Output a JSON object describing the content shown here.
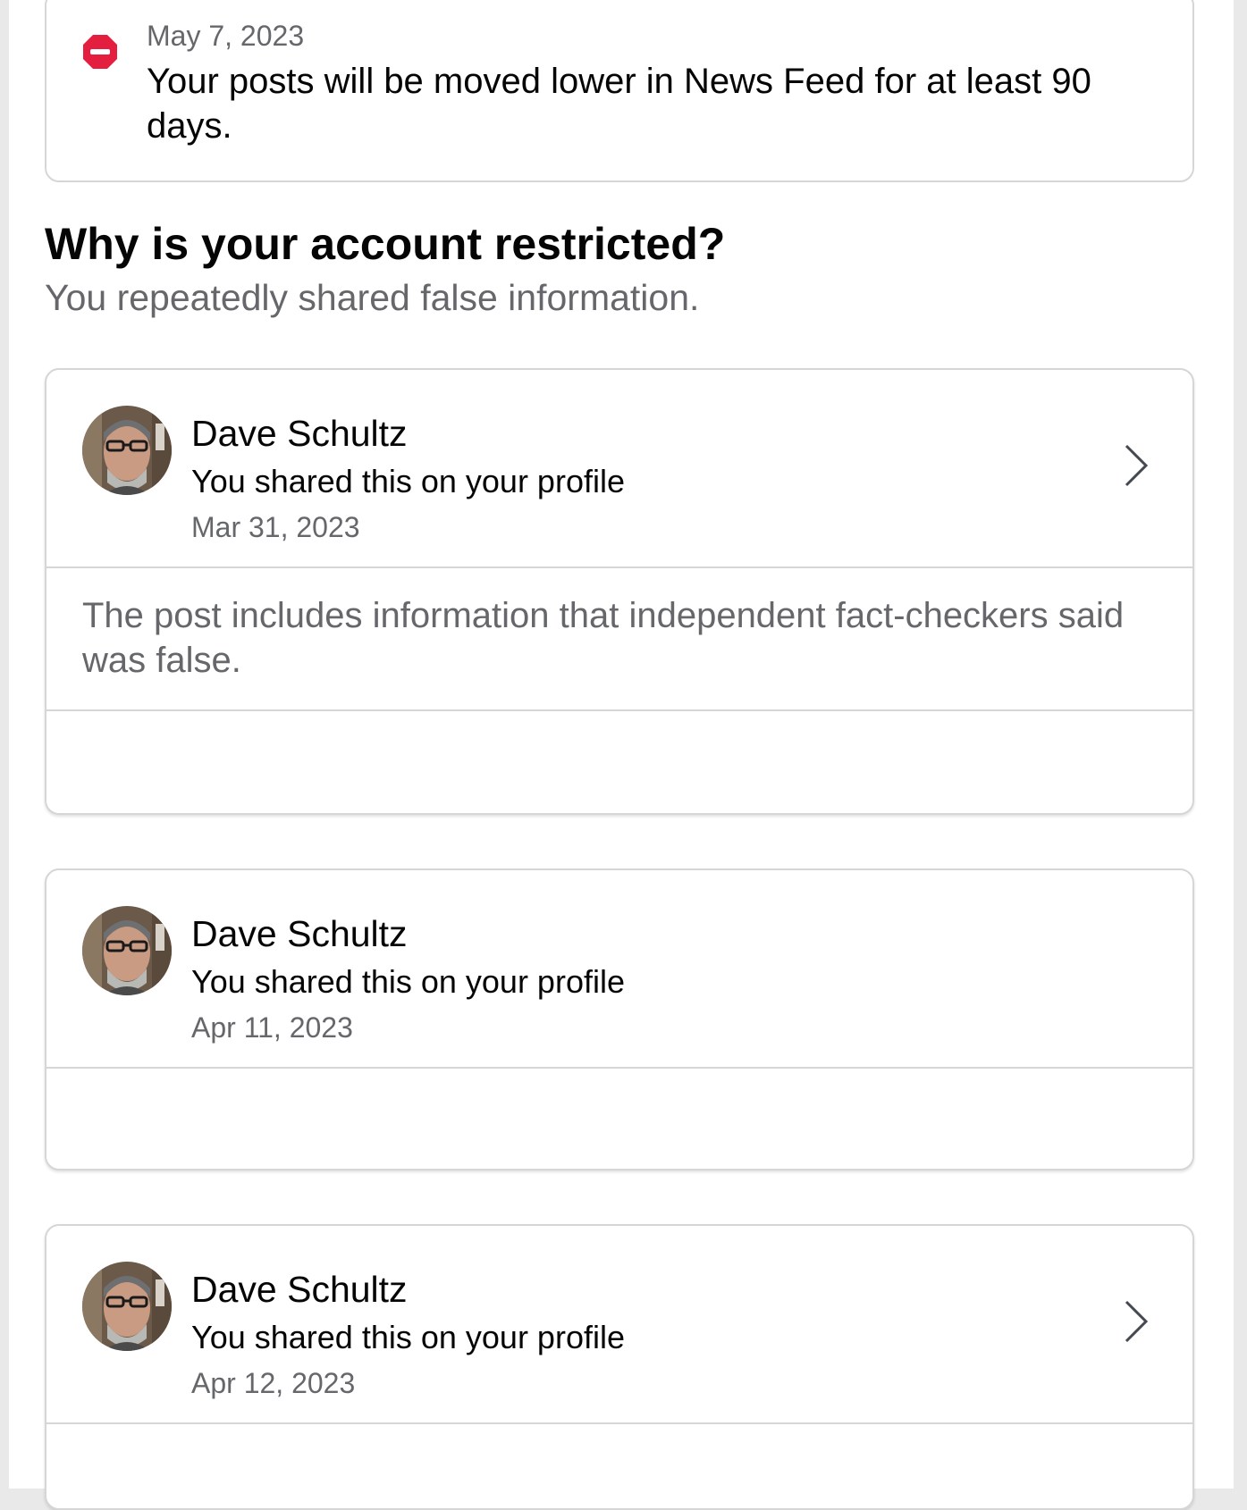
{
  "alert": {
    "date": "May 7, 2023",
    "message": "Your posts will be moved lower in News Feed for at least 90 days.",
    "icon": "stop-icon",
    "icon_color": "#e41e3f"
  },
  "section": {
    "heading": "Why is your account restricted?",
    "subheading": "You repeatedly shared false information."
  },
  "posts": [
    {
      "name": "Dave Schultz",
      "shared": "You shared this on your profile",
      "date": "Mar 31, 2023",
      "reason": "The post includes information that independent fact-checkers said was false.",
      "has_chevron": true
    },
    {
      "name": "Dave Schultz",
      "shared": "You shared this on your profile",
      "date": "Apr 11, 2023",
      "has_chevron": false
    },
    {
      "name": "Dave Schultz",
      "shared": "You shared this on your profile",
      "date": "Apr 12, 2023",
      "has_chevron": true
    }
  ],
  "colors": {
    "primary_text": "#050505",
    "secondary_text": "#65676b",
    "divider": "#d6d6d6"
  }
}
